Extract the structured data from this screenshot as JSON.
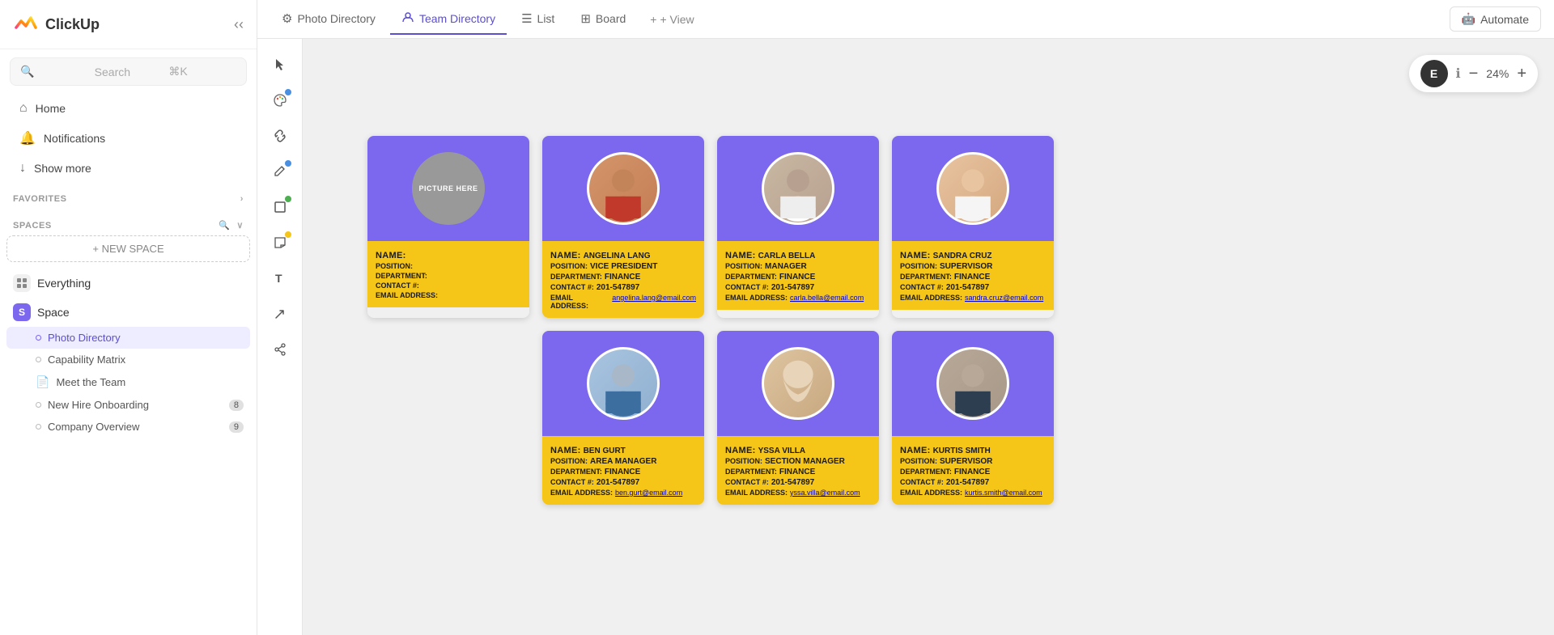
{
  "app": {
    "name": "ClickUp"
  },
  "sidebar": {
    "search": {
      "placeholder": "Search",
      "shortcut": "⌘K"
    },
    "nav": [
      {
        "id": "home",
        "label": "Home",
        "icon": "home"
      },
      {
        "id": "notifications",
        "label": "Notifications",
        "icon": "bell"
      },
      {
        "id": "show-more",
        "label": "Show more",
        "icon": "chevron-down"
      }
    ],
    "favorites_label": "FAVORITES",
    "spaces_label": "SPACES",
    "new_space_label": "+ NEW SPACE",
    "spaces": [
      {
        "id": "everything",
        "label": "Everything",
        "type": "everything"
      },
      {
        "id": "space",
        "label": "Space",
        "type": "space",
        "badge": "S"
      }
    ],
    "sub_items": [
      {
        "id": "photo-directory",
        "label": "Photo Directory",
        "active": true
      },
      {
        "id": "capability-matrix",
        "label": "Capability Matrix",
        "active": false
      }
    ],
    "doc_items": [
      {
        "id": "meet-the-team",
        "label": "Meet the Team",
        "icon": "doc"
      }
    ],
    "more_sub_items": [
      {
        "id": "new-hire-onboarding",
        "label": "New Hire Onboarding",
        "badge": "8"
      },
      {
        "id": "company-overview",
        "label": "Company Overview",
        "badge": "9"
      }
    ]
  },
  "tabs": [
    {
      "id": "photo-directory",
      "label": "Photo Directory",
      "icon": "⚙",
      "active": false
    },
    {
      "id": "team-directory",
      "label": "Team Directory",
      "icon": "🔗",
      "active": true
    },
    {
      "id": "list",
      "label": "List",
      "icon": "≡",
      "active": false
    },
    {
      "id": "board",
      "label": "Board",
      "icon": "▦",
      "active": false
    }
  ],
  "add_view": "+ View",
  "automate": "Automate",
  "zoom": {
    "percent": "24%",
    "avatar_label": "E"
  },
  "template_card": {
    "name_label": "NAME:",
    "position_label": "POSITION:",
    "department_label": "DEPARTMENT:",
    "contact_label": "CONTACT #:",
    "email_label": "EMAIL ADDRESS:"
  },
  "cards": [
    {
      "id": "template",
      "name": "",
      "position": "",
      "department": "",
      "contact": "",
      "email": "",
      "is_template": true
    },
    {
      "id": "angelina-lang",
      "name": "ANGELINA LANG",
      "position": "VICE PRESIDENT",
      "department": "FINANCE",
      "contact": "201-547897",
      "email": "angelina.lang@email.com",
      "is_template": false,
      "person_class": "person-1"
    },
    {
      "id": "carla-bella",
      "name": "CARLA BELLA",
      "position": "MANAGER",
      "department": "FINANCE",
      "contact": "201-547897",
      "email": "carla.bella@email.com",
      "is_template": false,
      "person_class": "person-2"
    },
    {
      "id": "sandra-cruz",
      "name": "SANDRA CRUZ",
      "position": "SUPERVISOR",
      "department": "FINANCE",
      "contact": "201-547897",
      "email": "sandra.cruz@email.com",
      "is_template": false,
      "person_class": "person-3"
    },
    {
      "id": "ben-gurt",
      "name": "BEN GURT",
      "position": "AREA MANAGER",
      "department": "FINANCE",
      "contact": "201-547897",
      "email": "ben.gurt@email.com",
      "is_template": false,
      "person_class": "person-4"
    },
    {
      "id": "yssa-villa",
      "name": "YSSA VILLA",
      "position": "SECTION MANAGER",
      "department": "FINANCE",
      "contact": "201-547897",
      "email": "yssa.villa@email.com",
      "is_template": false,
      "person_class": "person-5"
    },
    {
      "id": "kurtis-smith",
      "name": "KURTIS SMITH",
      "position": "SUPERVISOR",
      "department": "FINANCE",
      "contact": "201-547897",
      "email": "kurtis.smith@email.com",
      "is_template": false,
      "person_class": "person-6"
    }
  ],
  "tools": [
    {
      "id": "select",
      "icon": "▷",
      "dot": null
    },
    {
      "id": "palette",
      "icon": "✦",
      "dot": "blue"
    },
    {
      "id": "link",
      "icon": "🔗",
      "dot": null
    },
    {
      "id": "pencil",
      "icon": "✏",
      "dot": null
    },
    {
      "id": "rectangle",
      "icon": "□",
      "dot": "green"
    },
    {
      "id": "sticky",
      "icon": "⬜",
      "dot": "yellow"
    },
    {
      "id": "text",
      "icon": "T",
      "dot": null
    },
    {
      "id": "arrow",
      "icon": "↗",
      "dot": null
    },
    {
      "id": "share",
      "icon": "⬡",
      "dot": null
    }
  ]
}
